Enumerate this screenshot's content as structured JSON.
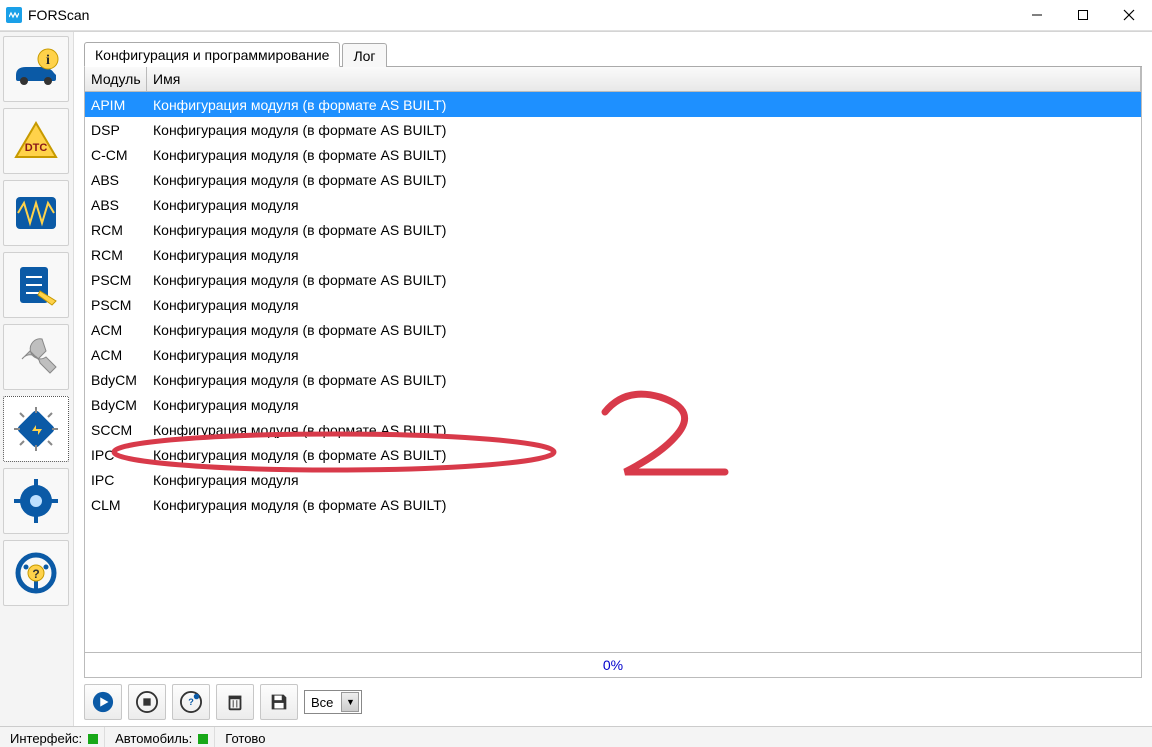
{
  "window": {
    "title": "FORScan"
  },
  "tabs": {
    "config": "Конфигурация и программирование",
    "log": "Лог"
  },
  "columns": {
    "module": "Модуль",
    "name": "Имя"
  },
  "rows": [
    {
      "module": "APIM",
      "name": "Конфигурация модуля (в формате AS BUILT)",
      "selected": true
    },
    {
      "module": "DSP",
      "name": "Конфигурация модуля (в формате AS BUILT)"
    },
    {
      "module": "C-CM",
      "name": "Конфигурация модуля (в формате AS BUILT)"
    },
    {
      "module": "ABS",
      "name": "Конфигурация модуля (в формате AS BUILT)"
    },
    {
      "module": "ABS",
      "name": "Конфигурация модуля"
    },
    {
      "module": "RCM",
      "name": "Конфигурация модуля (в формате AS BUILT)"
    },
    {
      "module": "RCM",
      "name": "Конфигурация модуля"
    },
    {
      "module": "PSCM",
      "name": "Конфигурация модуля (в формате AS BUILT)"
    },
    {
      "module": "PSCM",
      "name": "Конфигурация модуля"
    },
    {
      "module": "ACM",
      "name": "Конфигурация модуля (в формате AS BUILT)"
    },
    {
      "module": "ACM",
      "name": "Конфигурация модуля"
    },
    {
      "module": "BdyCM",
      "name": "Конфигурация модуля (в формате AS BUILT)"
    },
    {
      "module": "BdyCM",
      "name": "Конфигурация модуля"
    },
    {
      "module": "SCCM",
      "name": "Конфигурация модуля (в формате AS BUILT)"
    },
    {
      "module": "IPC",
      "name": "Конфигурация модуля (в формате AS BUILT)",
      "highlightRow": true
    },
    {
      "module": "IPC",
      "name": "Конфигурация модуля"
    },
    {
      "module": "CLM",
      "name": "Конфигурация модуля (в формате AS BUILT)"
    }
  ],
  "progress": "0%",
  "filter": {
    "selected": "Все"
  },
  "statusbar": {
    "interface": "Интерфейс:",
    "vehicle": "Автомобиль:",
    "ready": "Готово"
  },
  "annotation": {
    "label": "2",
    "color": "#d83a4a"
  }
}
